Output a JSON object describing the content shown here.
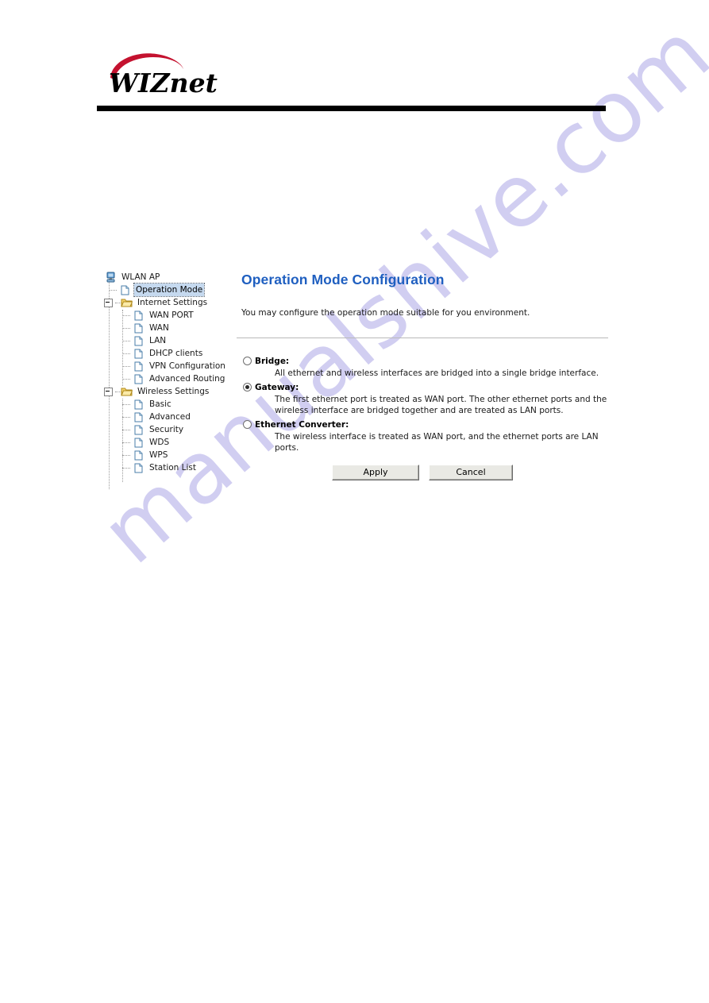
{
  "header": {
    "logo_text": "WIZnet",
    "logo_name": "wiznet-logo"
  },
  "watermark": {
    "text": "manualshive.com"
  },
  "tree": {
    "root_label": "WLAN AP",
    "items": [
      {
        "label": "Operation Mode",
        "icon": "page-icon",
        "level": 1,
        "selected": true,
        "type": "leaf"
      },
      {
        "label": "Internet Settings",
        "icon": "folder-icon",
        "level": 1,
        "selected": false,
        "type": "folder",
        "expanded": true
      },
      {
        "label": "WAN PORT",
        "icon": "page-icon",
        "level": 2,
        "selected": false,
        "type": "leaf"
      },
      {
        "label": "WAN",
        "icon": "page-icon",
        "level": 2,
        "selected": false,
        "type": "leaf"
      },
      {
        "label": "LAN",
        "icon": "page-icon",
        "level": 2,
        "selected": false,
        "type": "leaf"
      },
      {
        "label": "DHCP clients",
        "icon": "page-icon",
        "level": 2,
        "selected": false,
        "type": "leaf"
      },
      {
        "label": "VPN Configuration",
        "icon": "page-icon",
        "level": 2,
        "selected": false,
        "type": "leaf"
      },
      {
        "label": "Advanced Routing",
        "icon": "page-icon",
        "level": 2,
        "selected": false,
        "type": "leaf"
      },
      {
        "label": "Wireless Settings",
        "icon": "folder-icon",
        "level": 1,
        "selected": false,
        "type": "folder",
        "expanded": true
      },
      {
        "label": "Basic",
        "icon": "page-icon",
        "level": 2,
        "selected": false,
        "type": "leaf"
      },
      {
        "label": "Advanced",
        "icon": "page-icon",
        "level": 2,
        "selected": false,
        "type": "leaf"
      },
      {
        "label": "Security",
        "icon": "page-icon",
        "level": 2,
        "selected": false,
        "type": "leaf"
      },
      {
        "label": "WDS",
        "icon": "page-icon",
        "level": 2,
        "selected": false,
        "type": "leaf"
      },
      {
        "label": "WPS",
        "icon": "page-icon",
        "level": 2,
        "selected": false,
        "type": "leaf"
      },
      {
        "label": "Station List",
        "icon": "page-icon",
        "level": 2,
        "selected": false,
        "type": "leaf"
      }
    ]
  },
  "content": {
    "title": "Operation Mode Configuration",
    "intro": "You may configure the operation mode suitable for you environment.",
    "options": [
      {
        "label": "Bridge:",
        "selected": false,
        "description": "All ethernet and wireless interfaces are bridged into a single bridge interface."
      },
      {
        "label": "Gateway:",
        "selected": true,
        "description": "The first ethernet port is treated as WAN port. The other ethernet ports and the wireless interface are bridged together and are treated as LAN ports."
      },
      {
        "label": "Ethernet Converter:",
        "selected": false,
        "description": "The wireless interface is treated as WAN port, and the ethernet ports are LAN ports."
      }
    ],
    "buttons": {
      "apply": "Apply",
      "cancel": "Cancel"
    }
  },
  "colors": {
    "title_blue": "#1f5fc0",
    "selection_blue": "#c5d9ef",
    "watermark_lavender": "#c9c6ef",
    "logo_red": "#c4122f",
    "rule_black": "#000000"
  }
}
